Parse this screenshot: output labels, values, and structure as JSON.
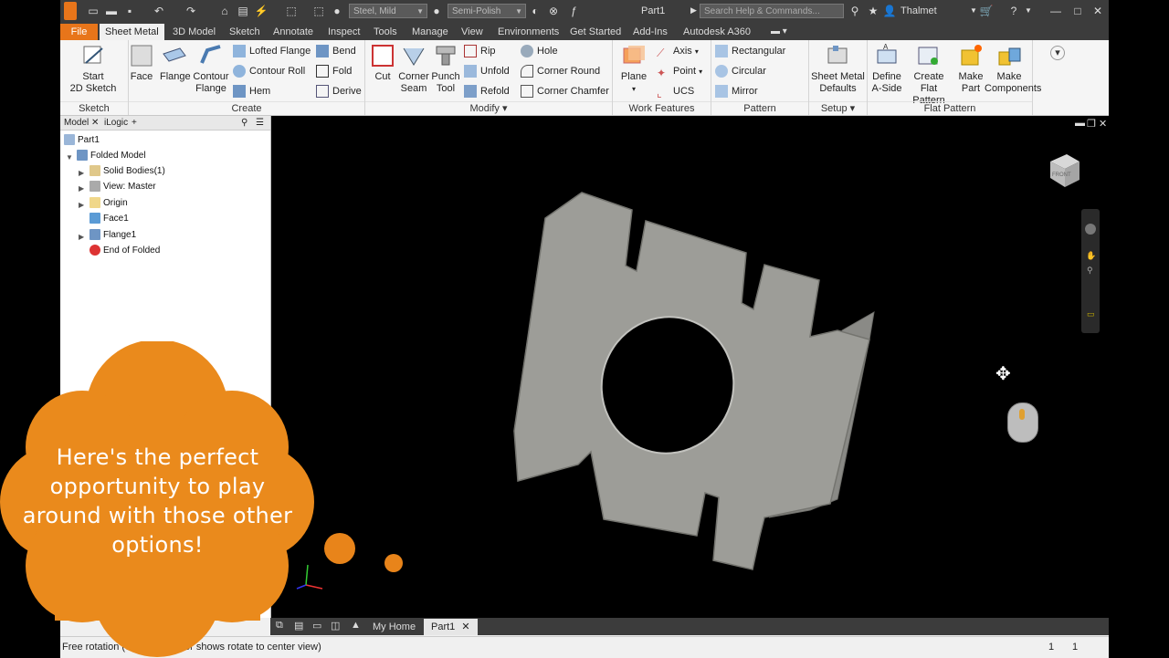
{
  "titlebar": {
    "material": "Steel, Mild",
    "appearance": "Semi-Polish",
    "document": "Part1",
    "search_placeholder": "Search Help & Commands...",
    "user": "Thalmet"
  },
  "menu_tabs": [
    "File",
    "Sheet Metal",
    "3D Model",
    "Sketch",
    "Annotate",
    "Inspect",
    "Tools",
    "Manage",
    "View",
    "Environments",
    "Get Started",
    "Add-Ins",
    "Autodesk A360"
  ],
  "ribbon": {
    "sketch": {
      "start_line1": "Start",
      "start_line2": "2D Sketch",
      "label": "Sketch"
    },
    "create": {
      "face": "Face",
      "flange": "Flange",
      "contour_line1": "Contour",
      "contour_line2": "Flange",
      "lofted": "Lofted Flange",
      "contour_roll": "Contour Roll",
      "hem": "Hem",
      "bend": "Bend",
      "fold": "Fold",
      "derive": "Derive",
      "label": "Create"
    },
    "modify": {
      "cut": "Cut",
      "corner_seam_line1": "Corner",
      "corner_seam_line2": "Seam",
      "punch_line1": "Punch",
      "punch_line2": "Tool",
      "rip": "Rip",
      "unfold": "Unfold",
      "refold": "Refold",
      "hole": "Hole",
      "corner_round": "Corner Round",
      "corner_chamfer": "Corner Chamfer",
      "label": "Modify"
    },
    "work_features": {
      "plane": "Plane",
      "axis": "Axis",
      "point": "Point",
      "ucs": "UCS",
      "label": "Work Features"
    },
    "pattern": {
      "rectangular": "Rectangular",
      "circular": "Circular",
      "mirror": "Mirror",
      "label": "Pattern"
    },
    "setup": {
      "defaults_line1": "Sheet Metal",
      "defaults_line2": "Defaults",
      "label": "Setup"
    },
    "flat_pattern": {
      "define_line1": "Define",
      "define_line2": "A-Side",
      "create_line1": "Create",
      "create_line2": "Flat Pattern",
      "make_part_line1": "Make",
      "make_part_line2": "Part",
      "make_comp_line1": "Make",
      "make_comp_line2": "Components",
      "label": "Flat Pattern"
    }
  },
  "browser": {
    "tab_model": "Model",
    "tab_ilogic": "iLogic",
    "part": "Part1",
    "items": [
      "Folded Model",
      "Solid Bodies(1)",
      "View: Master",
      "Origin",
      "Face1",
      "Flange1",
      "End of Folded"
    ]
  },
  "doc_tabs": {
    "home": "My Home",
    "part": "Part1"
  },
  "status": {
    "text": "Free rotation (c",
    "text2": "or shows rotate to center view)",
    "num1": "1",
    "num2": "1"
  },
  "overlay": {
    "message": "Here's the perfect opportunity to play around with those other options!"
  },
  "viewcube": {
    "label": "FRONT"
  }
}
